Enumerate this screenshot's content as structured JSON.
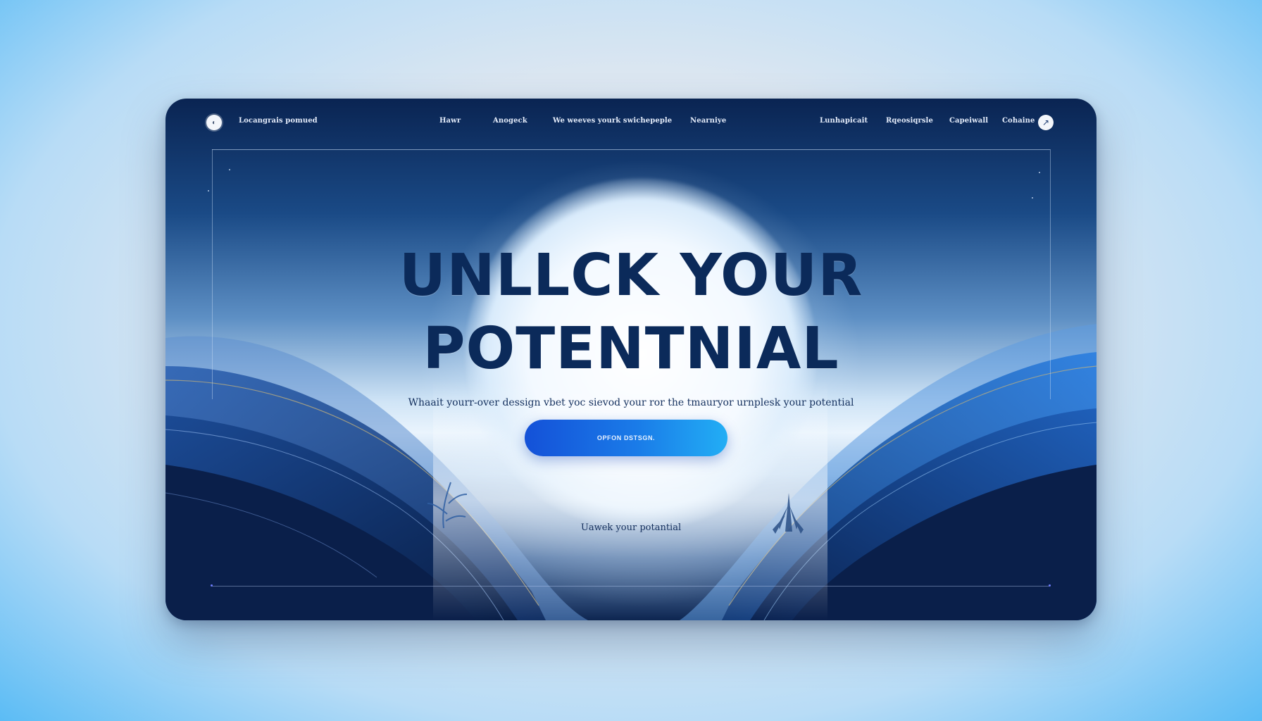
{
  "nav": {
    "brand": "Locangrais pomued",
    "links": [
      "Hawr",
      "Anogeck",
      "We weeves yourk swichepeple",
      "Nearniye"
    ],
    "right_links": [
      "Lunhapicait",
      "Rqeosiqrsle",
      "Capeiwall",
      "Cohaine"
    ]
  },
  "hero": {
    "headline_line1": "UNLLCK YOUR",
    "headline_line2": "POTENTNIAL",
    "subtitle": "Whaait yourr-over dessign vbet yoc sievod your ror the tmauryor urnplesk your potential",
    "cta_label": "OPFON DSTSGN.",
    "footnote": "Uawek your potantial"
  },
  "icons": {
    "logo": "logo-circle-icon",
    "action": "arrow-diagonal-icon"
  },
  "colors": {
    "accent": "#1a7be8",
    "headline": "#0b2a5a",
    "card_dark": "#0a2452"
  }
}
